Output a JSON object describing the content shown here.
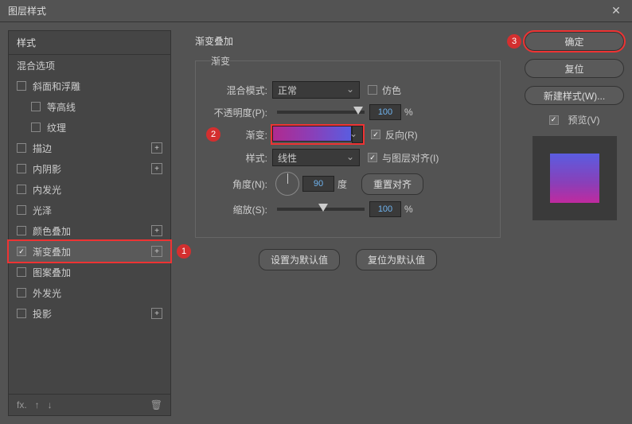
{
  "window": {
    "title": "图层样式"
  },
  "sidebar": {
    "header": "样式",
    "blend_options": "混合选项",
    "items": [
      {
        "label": "斜面和浮雕",
        "checked": false,
        "has_plus": false,
        "indent": false
      },
      {
        "label": "等高线",
        "checked": false,
        "has_plus": false,
        "indent": true
      },
      {
        "label": "纹理",
        "checked": false,
        "has_plus": false,
        "indent": true
      },
      {
        "label": "描边",
        "checked": false,
        "has_plus": true,
        "indent": false
      },
      {
        "label": "内阴影",
        "checked": false,
        "has_plus": true,
        "indent": false
      },
      {
        "label": "内发光",
        "checked": false,
        "has_plus": false,
        "indent": false
      },
      {
        "label": "光泽",
        "checked": false,
        "has_plus": false,
        "indent": false
      },
      {
        "label": "颜色叠加",
        "checked": false,
        "has_plus": true,
        "indent": false
      },
      {
        "label": "渐变叠加",
        "checked": true,
        "has_plus": true,
        "indent": false,
        "selected": true,
        "highlight": true,
        "badge": "1"
      },
      {
        "label": "图案叠加",
        "checked": false,
        "has_plus": false,
        "indent": false
      },
      {
        "label": "外发光",
        "checked": false,
        "has_plus": false,
        "indent": false
      },
      {
        "label": "投影",
        "checked": false,
        "has_plus": true,
        "indent": false
      }
    ]
  },
  "center": {
    "title": "渐变叠加",
    "group_label": "渐变",
    "blend_mode_label": "混合模式:",
    "blend_mode_value": "正常",
    "dither_label": "仿色",
    "opacity_label": "不透明度(P):",
    "opacity_value": "100",
    "opacity_unit": "%",
    "gradient_label": "渐变:",
    "gradient_badge": "2",
    "reverse_label": "反向(R)",
    "style_label": "样式:",
    "style_value": "线性",
    "align_label": "与图层对齐(I)",
    "angle_label": "角度(N):",
    "angle_value": "90",
    "angle_unit": "度",
    "reset_align": "重置对齐",
    "scale_label": "缩放(S):",
    "scale_value": "100",
    "scale_unit": "%",
    "set_default": "设置为默认值",
    "reset_default": "复位为默认值"
  },
  "right": {
    "ok": "确定",
    "ok_badge": "3",
    "cancel": "复位",
    "new_style": "新建样式(W)...",
    "preview_label": "预览(V)"
  }
}
